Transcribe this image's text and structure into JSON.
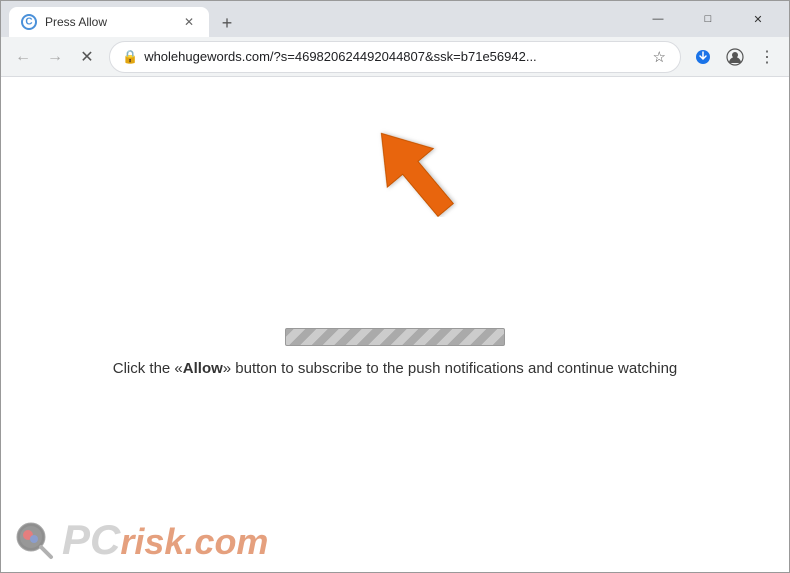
{
  "titlebar": {
    "tab_title": "Press Allow",
    "new_tab_label": "+",
    "close_label": "✕",
    "minimize_label": "—",
    "maximize_label": "□"
  },
  "toolbar": {
    "url": "wholehugewords.com/?s=469820624492044807&ssk=b71e56942...",
    "back_label": "←",
    "forward_label": "→",
    "reload_label": "✕",
    "lock_icon": "🔒",
    "star_label": "☆",
    "profile_label": "👤",
    "menu_label": "⋮",
    "download_label": "⬇"
  },
  "content": {
    "instruction": "Click the «Allow» button to subscribe to the push notifications and continue watching",
    "allow_word": "Allow"
  },
  "watermark": {
    "pc_text": "PC",
    "risk_text": "risk.com"
  }
}
